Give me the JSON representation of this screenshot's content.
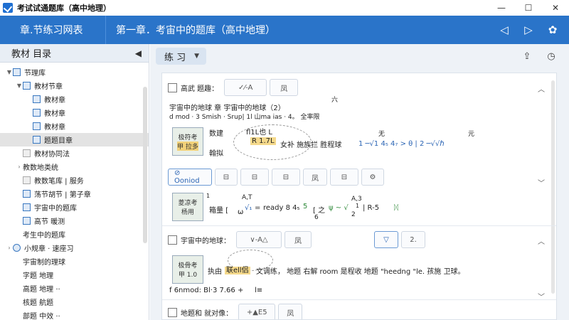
{
  "window": {
    "title": "考试试通题库（高中地理）",
    "controls": [
      "—",
      "☐",
      "✕"
    ]
  },
  "header": {
    "left_title": "章.节练习网表",
    "main_title": "第一章．考宙中的题库（高中地理）",
    "nav": [
      "◁",
      "▷",
      "✿"
    ]
  },
  "sidebar": {
    "title": "教材 目录",
    "collapse_icon": "◀",
    "items": [
      {
        "label": "节理库",
        "level": 0,
        "arrow": "▼",
        "icon": "book"
      },
      {
        "label": "教材节章",
        "level": 1,
        "arrow": "▼",
        "icon": "folder"
      },
      {
        "label": "教材章",
        "level": 2,
        "arrow": "",
        "icon": "doc"
      },
      {
        "label": "教材章",
        "level": 2,
        "arrow": "",
        "icon": "doc"
      },
      {
        "label": "教材章",
        "level": 2,
        "arrow": "",
        "icon": "doc"
      },
      {
        "label": "题题目章",
        "level": 2,
        "arrow": "",
        "icon": "doc",
        "selected": true
      },
      {
        "label": "教材协同法",
        "level": 1,
        "arrow": "",
        "icon": "gray"
      },
      {
        "label": "教数地类统",
        "level": 1,
        "arrow": "›",
        "icon": "none"
      },
      {
        "label": "教数笔库 | 服务",
        "level": 1,
        "arrow": "",
        "icon": "gray"
      },
      {
        "label": "荡节胡节 | 第子章",
        "level": 1,
        "arrow": "",
        "icon": "doc"
      },
      {
        "label": "宇宙中的题库",
        "level": 1,
        "arrow": "",
        "icon": "doc"
      },
      {
        "label": "高节 暖测",
        "level": 1,
        "arrow": "",
        "icon": "doc"
      },
      {
        "label": "考生中的题库",
        "level": 1,
        "arrow": "",
        "icon": "none"
      },
      {
        "label": "小规章 · 速座习",
        "level": 0,
        "arrow": "›",
        "icon": "round"
      },
      {
        "label": "宇宙制的理球",
        "level": 1,
        "arrow": "",
        "icon": "none"
      },
      {
        "label": "字题  地理",
        "level": 1,
        "arrow": "",
        "icon": "none"
      },
      {
        "label": "高题  地理 ··",
        "level": 1,
        "arrow": "",
        "icon": "none"
      },
      {
        "label": "核题  航题",
        "level": 1,
        "arrow": "",
        "icon": "none"
      },
      {
        "label": "部题  中效 ··",
        "level": 1,
        "arrow": "",
        "icon": "none"
      }
    ]
  },
  "toolbar": {
    "practice_label": "练 习",
    "caret": "▼",
    "icons": [
      "⇪",
      "◷"
    ]
  },
  "questions": [
    {
      "label": "高武 题趣：",
      "chips": [
        "✓⁄-A",
        "凤"
      ],
      "expand": "︿",
      "title": "宇宙中的地球  章 宇宙中的地球（2）",
      "meta": "d mod · 3 Smish · Srup| 1l 山ma ias ·   4。 全率限",
      "meta_sup": "六",
      "thumb_a": "极符考",
      "thumb_b": "甲 拉多",
      "side_a": "数建",
      "side_b": "翰拟",
      "expr_top": "fl1L也 L",
      "expr_box": "R 1.7L",
      "expr_rest": "女补 施族拦 胜程球",
      "expr_tail": "1 ─√1 4₅   4₇  >  θ  |  2 ─√√ℏ",
      "expr_tail_sup": "无",
      "expr_tail_sup2": "元",
      "tools": [
        "⊘ Ooniod",
        "⊟",
        "⊟",
        "⊟",
        "凤",
        "⊟",
        "⚙"
      ],
      "expand2": "﹀"
    },
    {
      "thumb_a": "菱凉考",
      "thumb_b": "杨用",
      "num1": "1",
      "lead": "箱量 [",
      "expr_a": "ω",
      "expr_b": "√₁",
      "expr_c": "=",
      "expr_d": "ready 8 4₅",
      "expr_e": "5",
      "expr_f": "[ 之",
      "expr_g": "6",
      "expr_h": "ψ ~ √",
      "expr_i": "2",
      "expr_j": "| R-5",
      "expr_k": "ᛞ",
      "top_a": "A,T",
      "top_b": "A,3",
      "top_c": "1"
    },
    {
      "label": "宇宙中的地球：",
      "chips": [
        "∨-A△",
        "凤"
      ],
      "chips_right": [
        "▽",
        "2."
      ],
      "expand": "︿",
      "thumb_a": "极骨考",
      "thumb_b": "甲 1.0",
      "lead": "执由",
      "box": "联ell侣",
      "text": "文调练，   地题 右解 room 是程收 地题 \"heedng \"le. 孩施 卫球。",
      "formula": "f 6nmod:  Bl·3  7.66  +",
      "formula_mark": "l≡",
      "expand2": "﹀"
    },
    {
      "label": "地题和 就对像：",
      "chips": [
        "+▲E5",
        "凤"
      ]
    }
  ]
}
